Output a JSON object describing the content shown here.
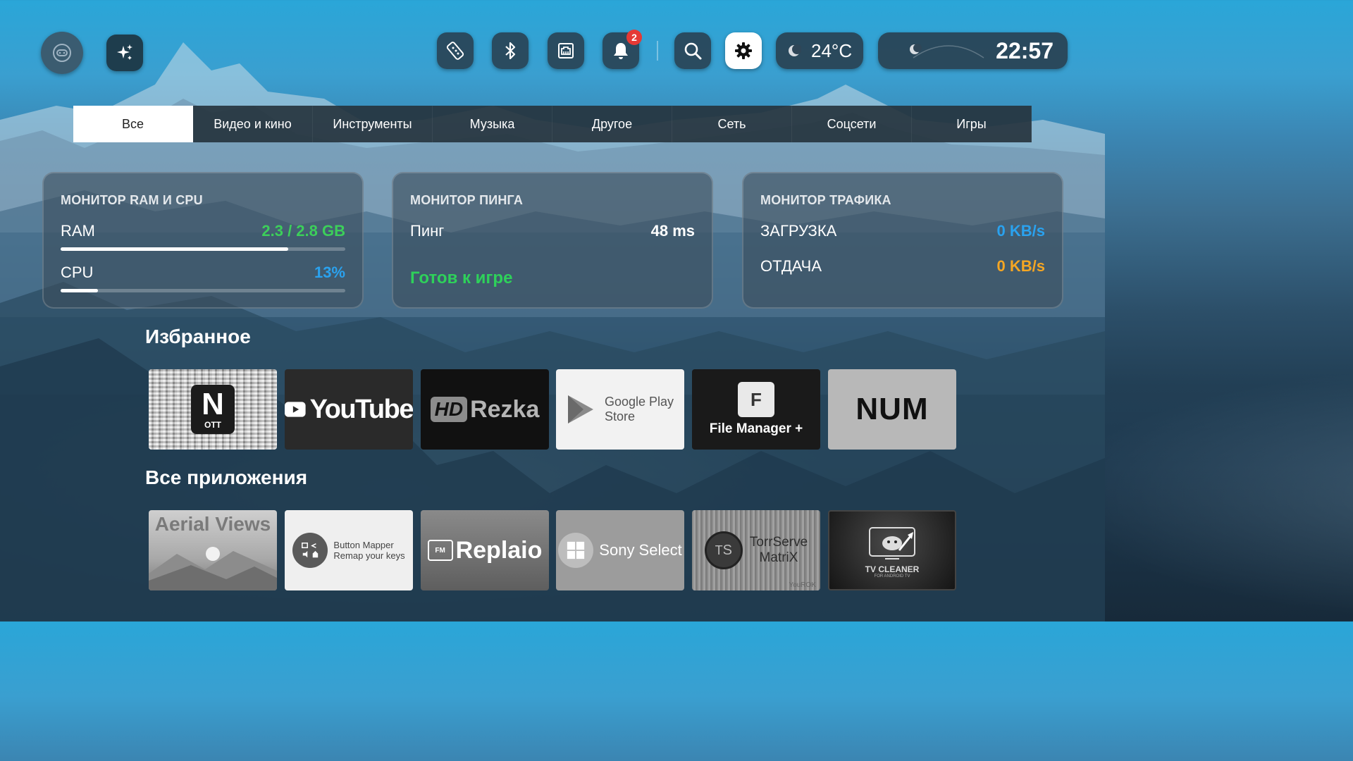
{
  "topbar": {
    "notifications_count": "2",
    "weather": {
      "temperature": "24°C"
    },
    "clock": {
      "time": "22:57"
    }
  },
  "tabs": [
    {
      "label": "Все",
      "active": true
    },
    {
      "label": "Видео и кино",
      "active": false
    },
    {
      "label": "Инструменты",
      "active": false
    },
    {
      "label": "Музыка",
      "active": false
    },
    {
      "label": "Другое",
      "active": false
    },
    {
      "label": "Сеть",
      "active": false
    },
    {
      "label": "Соцсети",
      "active": false
    },
    {
      "label": "Игры",
      "active": false
    }
  ],
  "monitors": {
    "ram_cpu": {
      "title": "МОНИТОР RAM И CPU",
      "ram_label": "RAM",
      "ram_value": "2.3 / 2.8 GB",
      "ram_fraction": 0.8,
      "cpu_label": "CPU",
      "cpu_value": "13%",
      "cpu_fraction": 0.13
    },
    "ping": {
      "title": "МОНИТОР ПИНГА",
      "ping_label": "Пинг",
      "ping_value": "48 ms",
      "status": "Готов к игре"
    },
    "traffic": {
      "title": "МОНИТОР ТРАФИКА",
      "download_label": "ЗАГРУЗКА",
      "download_value": "0 KB/s",
      "upload_label": "ОТДАЧА",
      "upload_value": "0 KB/s"
    }
  },
  "favorites": {
    "title": "Избранное",
    "apps": [
      {
        "name": "NOTT",
        "logo_text": "N",
        "sub_text": "OTT"
      },
      {
        "name": "YouTube",
        "logo_text": "YouTube"
      },
      {
        "name": "HDRezka",
        "logo_hd": "HD",
        "logo_text": "Rezka"
      },
      {
        "name": "Google Play Store",
        "logo_line1": "Google Play",
        "logo_line2": "Store"
      },
      {
        "name": "File Manager +",
        "logo_text": "File Manager +",
        "icon_letter": "F"
      },
      {
        "name": "NUM",
        "logo_text": "NUM"
      }
    ]
  },
  "all_apps": {
    "title": "Все приложения",
    "apps": [
      {
        "name": "Aerial Views",
        "logo_text": "Aerial Views"
      },
      {
        "name": "Button Mapper",
        "logo_line1": "Button Mapper",
        "logo_line2": "Remap your keys"
      },
      {
        "name": "Replaio",
        "logo_text": "Replaio",
        "icon_text": "FM"
      },
      {
        "name": "Sony Select",
        "logo_text": "Sony Select"
      },
      {
        "name": "TorrServe MatriX",
        "logo_line1": "TorrServe",
        "logo_line2": "MatriX",
        "icon_text1": "T",
        "icon_text2": "S",
        "watermark": "YouROK"
      },
      {
        "name": "TV Cleaner",
        "logo_text": "TV CLEANER",
        "sub_text": "FOR ANDROID TV"
      }
    ]
  },
  "colors": {
    "accent_green": "#3ccf5a",
    "accent_blue": "#2aa2ef",
    "accent_orange": "#f5a623",
    "badge_red": "#e53935"
  }
}
